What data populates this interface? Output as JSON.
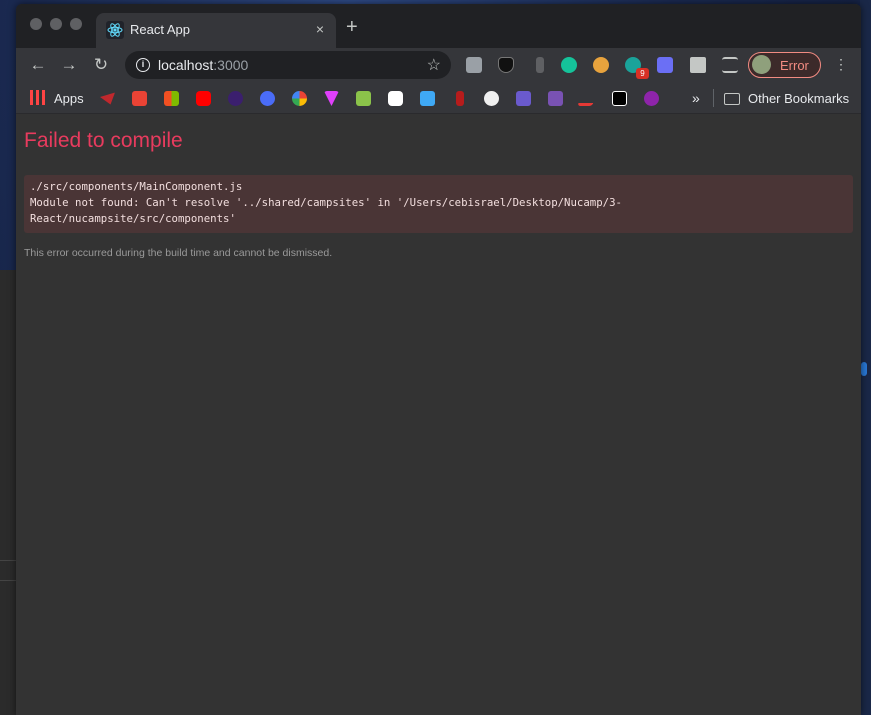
{
  "tab": {
    "title": "React App",
    "close": "×",
    "new_tab": "+"
  },
  "toolbar": {
    "back": "←",
    "forward": "→",
    "reload": "↻",
    "url_host": "localhost",
    "url_port": ":3000",
    "profile_label": "Error",
    "extension_badge": "9"
  },
  "bookmarks": {
    "apps_label": "Apps",
    "overflow": "»",
    "other_label": "Other Bookmarks"
  },
  "page": {
    "title": "Failed to compile",
    "error_message": "./src/components/MainComponent.js\nModule not found: Can't resolve '../shared/campsites' in '/Users/cebisrael/Desktop/Nucamp/3-\nReact/nucampsite/src/components'",
    "footer": "This error occurred during the build time and cannot be dismissed."
  },
  "colors": {
    "error_red": "#e83b5e",
    "error_bg": "#4a3536",
    "profile_outline": "#f28b82"
  }
}
